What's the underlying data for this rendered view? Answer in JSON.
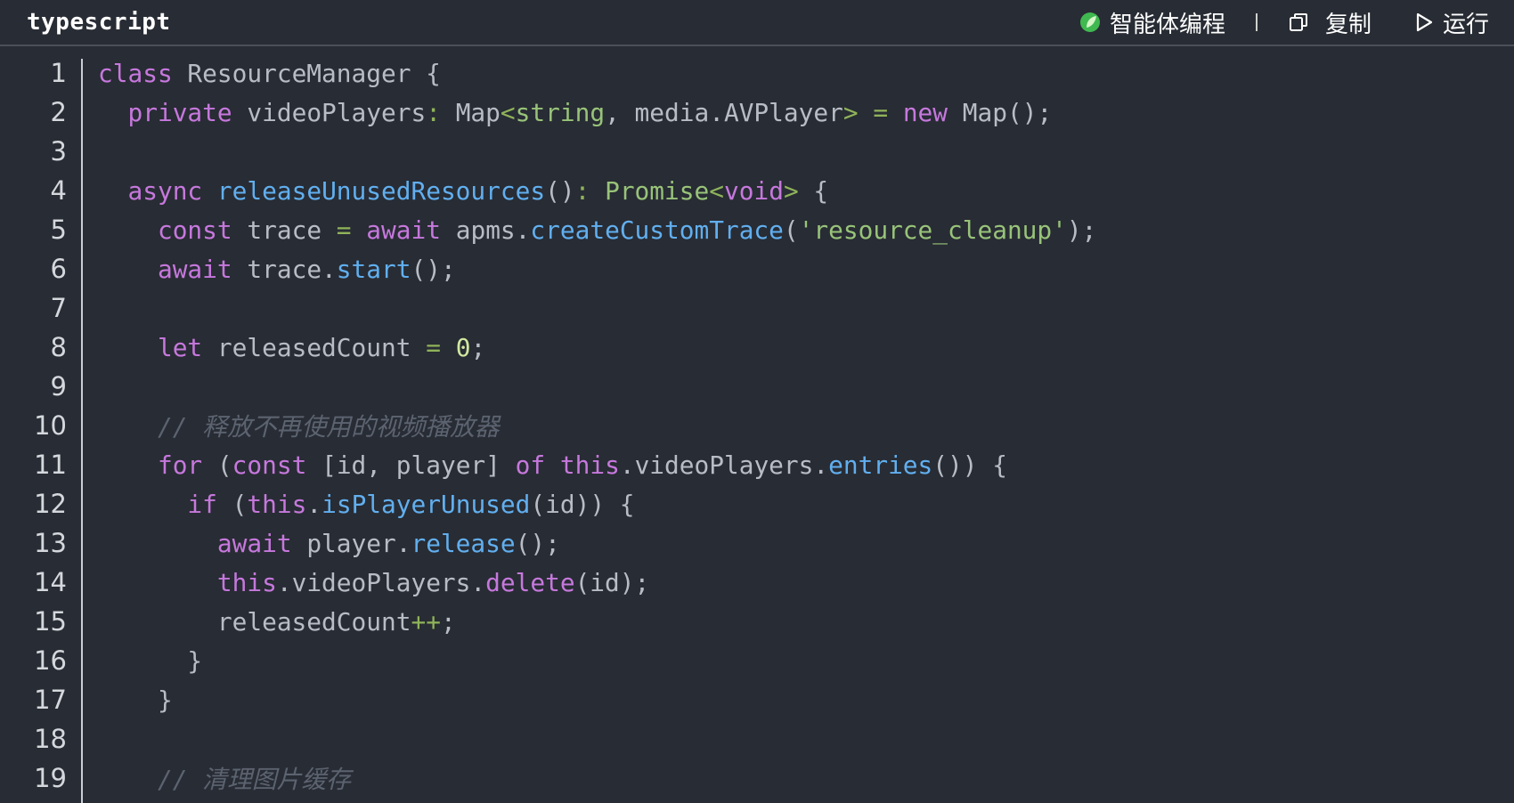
{
  "header": {
    "language": "typescript",
    "agent_label": "智能体编程",
    "copy_label": "复制",
    "run_label": "运行",
    "agent_icon_color": "#3fb950"
  },
  "colors": {
    "background": "#282c34",
    "keyword": "#c678dd",
    "function": "#61afef",
    "type": "#98c379",
    "string": "#98c379",
    "comment": "#5c6370",
    "text": "#b8bcc4"
  },
  "code": {
    "lines": [
      {
        "n": "1",
        "tokens": [
          {
            "t": "class",
            "k": "kw"
          },
          {
            "t": " ResourceManager {",
            "k": "tx"
          }
        ]
      },
      {
        "n": "2",
        "tokens": [
          {
            "t": "  ",
            "k": "tx"
          },
          {
            "t": "private",
            "k": "kw"
          },
          {
            "t": " videoPlayers",
            "k": "tx"
          },
          {
            "t": ": ",
            "k": "op"
          },
          {
            "t": "Map",
            "k": "tx"
          },
          {
            "t": "<",
            "k": "op"
          },
          {
            "t": "string",
            "k": "ty"
          },
          {
            "t": ", media.AVPlayer",
            "k": "tx"
          },
          {
            "t": ">",
            "k": "op"
          },
          {
            "t": " = ",
            "k": "op"
          },
          {
            "t": "new",
            "k": "kw"
          },
          {
            "t": " Map();",
            "k": "tx"
          }
        ]
      },
      {
        "n": "3",
        "tokens": []
      },
      {
        "n": "4",
        "tokens": [
          {
            "t": "  ",
            "k": "tx"
          },
          {
            "t": "async",
            "k": "kw"
          },
          {
            "t": " ",
            "k": "tx"
          },
          {
            "t": "releaseUnusedResources",
            "k": "fn"
          },
          {
            "t": "()",
            "k": "pu"
          },
          {
            "t": ": ",
            "k": "op"
          },
          {
            "t": "Promise",
            "k": "ty"
          },
          {
            "t": "<",
            "k": "op"
          },
          {
            "t": "void",
            "k": "kw"
          },
          {
            "t": ">",
            "k": "op"
          },
          {
            "t": " {",
            "k": "pu"
          }
        ]
      },
      {
        "n": "5",
        "tokens": [
          {
            "t": "    ",
            "k": "tx"
          },
          {
            "t": "const",
            "k": "kw"
          },
          {
            "t": " trace ",
            "k": "tx"
          },
          {
            "t": "=",
            "k": "op"
          },
          {
            "t": " ",
            "k": "tx"
          },
          {
            "t": "await",
            "k": "kw"
          },
          {
            "t": " apms.",
            "k": "tx"
          },
          {
            "t": "createCustomTrace",
            "k": "fn"
          },
          {
            "t": "(",
            "k": "pu"
          },
          {
            "t": "'resource_cleanup'",
            "k": "str"
          },
          {
            "t": ");",
            "k": "pu"
          }
        ]
      },
      {
        "n": "6",
        "tokens": [
          {
            "t": "    ",
            "k": "tx"
          },
          {
            "t": "await",
            "k": "kw"
          },
          {
            "t": " trace.",
            "k": "tx"
          },
          {
            "t": "start",
            "k": "fn"
          },
          {
            "t": "();",
            "k": "pu"
          }
        ]
      },
      {
        "n": "7",
        "tokens": []
      },
      {
        "n": "8",
        "tokens": [
          {
            "t": "    ",
            "k": "tx"
          },
          {
            "t": "let",
            "k": "kw"
          },
          {
            "t": " releasedCount ",
            "k": "tx"
          },
          {
            "t": "=",
            "k": "op"
          },
          {
            "t": " ",
            "k": "tx"
          },
          {
            "t": "0",
            "k": "num"
          },
          {
            "t": ";",
            "k": "pu"
          }
        ]
      },
      {
        "n": "9",
        "tokens": []
      },
      {
        "n": "10",
        "tokens": [
          {
            "t": "    ",
            "k": "tx"
          },
          {
            "t": "// 释放不再使用的视频播放器",
            "k": "cm"
          }
        ]
      },
      {
        "n": "11",
        "tokens": [
          {
            "t": "    ",
            "k": "tx"
          },
          {
            "t": "for",
            "k": "kw"
          },
          {
            "t": " (",
            "k": "pu"
          },
          {
            "t": "const",
            "k": "kw"
          },
          {
            "t": " [id, player] ",
            "k": "tx"
          },
          {
            "t": "of",
            "k": "kw"
          },
          {
            "t": " ",
            "k": "tx"
          },
          {
            "t": "this",
            "k": "kw"
          },
          {
            "t": ".videoPlayers.",
            "k": "tx"
          },
          {
            "t": "entries",
            "k": "fn"
          },
          {
            "t": "()) {",
            "k": "pu"
          }
        ]
      },
      {
        "n": "12",
        "tokens": [
          {
            "t": "      ",
            "k": "tx"
          },
          {
            "t": "if",
            "k": "kw"
          },
          {
            "t": " (",
            "k": "pu"
          },
          {
            "t": "this",
            "k": "kw"
          },
          {
            "t": ".",
            "k": "tx"
          },
          {
            "t": "isPlayerUnused",
            "k": "fn"
          },
          {
            "t": "(id)) {",
            "k": "pu"
          }
        ]
      },
      {
        "n": "13",
        "tokens": [
          {
            "t": "        ",
            "k": "tx"
          },
          {
            "t": "await",
            "k": "kw"
          },
          {
            "t": " player.",
            "k": "tx"
          },
          {
            "t": "release",
            "k": "fn"
          },
          {
            "t": "();",
            "k": "pu"
          }
        ]
      },
      {
        "n": "14",
        "tokens": [
          {
            "t": "        ",
            "k": "tx"
          },
          {
            "t": "this",
            "k": "kw"
          },
          {
            "t": ".videoPlayers.",
            "k": "tx"
          },
          {
            "t": "delete",
            "k": "kw"
          },
          {
            "t": "(id);",
            "k": "pu"
          }
        ]
      },
      {
        "n": "15",
        "tokens": [
          {
            "t": "        releasedCount",
            "k": "tx"
          },
          {
            "t": "++",
            "k": "op"
          },
          {
            "t": ";",
            "k": "pu"
          }
        ]
      },
      {
        "n": "16",
        "tokens": [
          {
            "t": "      }",
            "k": "pu"
          }
        ]
      },
      {
        "n": "17",
        "tokens": [
          {
            "t": "    }",
            "k": "pu"
          }
        ]
      },
      {
        "n": "18",
        "tokens": []
      },
      {
        "n": "19",
        "tokens": [
          {
            "t": "    ",
            "k": "tx"
          },
          {
            "t": "// 清理图片缓存",
            "k": "cm"
          }
        ]
      }
    ]
  }
}
